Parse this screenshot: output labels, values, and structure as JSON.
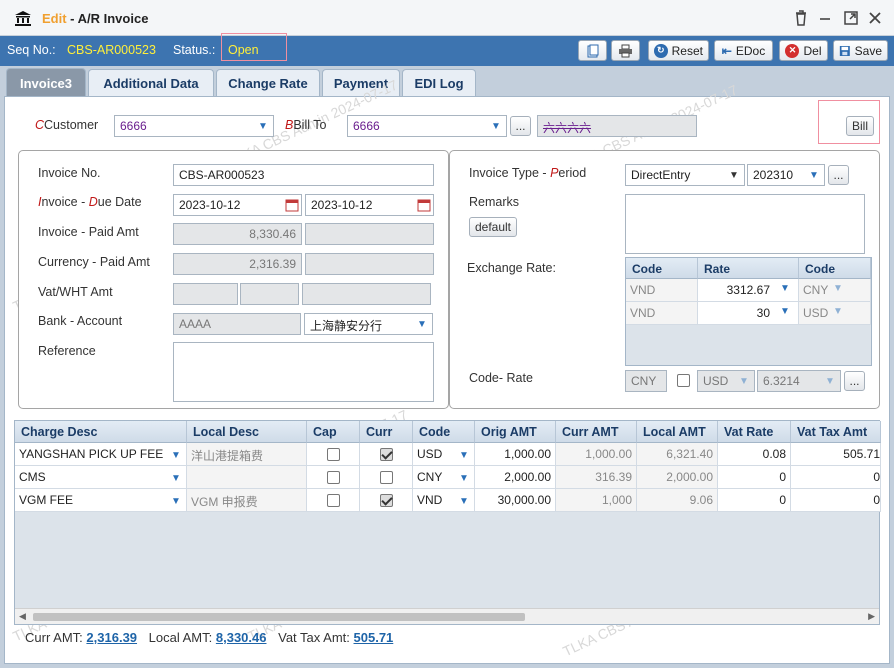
{
  "window": {
    "mode": "Edit",
    "title_rest": " - A/R Invoice"
  },
  "seq": {
    "label": "Seq No.:",
    "value": "CBS-AR000523",
    "status_label": "Status.:",
    "status_value": "Open"
  },
  "toolbar": {
    "reset": "Reset",
    "edoc": "EDoc",
    "del": "Del",
    "save": "Save"
  },
  "tabs": [
    "Invoice3",
    "Additional Data",
    "Change Rate",
    "Payment",
    "EDI Log"
  ],
  "header": {
    "customer_label": "Customer",
    "customer_value": "6666",
    "billto_label": "Bill To",
    "billto_value": "6666",
    "billto_name": "六六六六",
    "ellipsis": "...",
    "bill_button": "Bill"
  },
  "left": {
    "invoice_no_label": "Invoice No.",
    "invoice_no": "CBS-AR000523",
    "invoice_due_label": "Invoice - Due Date",
    "invoice_date": "2023-10-12",
    "due_date": "2023-10-12",
    "invoice_paid_label": "Invoice - Paid Amt",
    "invoice_amt": "8,330.46",
    "paid_amt": "",
    "currency_paid_label": "Currency - Paid Amt",
    "currency_amt": "2,316.39",
    "vat_label": "Vat/WHT Amt",
    "bank_label": "Bank - Account",
    "bank": "AAAA",
    "account": "上海静安分行",
    "reference_label": "Reference"
  },
  "right": {
    "type_period_label": "Invoice Type - Period",
    "type": "DirectEntry",
    "period": "202310",
    "remarks_label": "Remarks",
    "default_btn": "default",
    "exrate_label": "Exchange Rate:",
    "exrate_headers": [
      "Code",
      "Rate",
      "Code"
    ],
    "exrate_rows": [
      {
        "code": "VND",
        "rate": "3312.67",
        "code2": "CNY"
      },
      {
        "code": "VND",
        "rate": "30",
        "code2": "USD"
      }
    ],
    "code_rate_label": "Code- Rate",
    "code1": "CNY",
    "code2": "USD",
    "rate": "6.3214"
  },
  "grid": {
    "headers": [
      "Charge Desc",
      "Local Desc",
      "Cap",
      "Curr",
      "Code",
      "Orig AMT",
      "Curr AMT",
      "Local AMT",
      "Vat Rate",
      "Vat Tax Amt"
    ],
    "rows": [
      {
        "charge": "YANGSHAN PICK UP FEE",
        "local": "洋山港提箱费",
        "cap": false,
        "curr": true,
        "code": "USD",
        "orig": "1,000.00",
        "curr_amt": "1,000.00",
        "local_amt": "6,321.40",
        "vat_rate": "0.08",
        "vat_tax": "505.71"
      },
      {
        "charge": "CMS",
        "local": "",
        "cap": false,
        "curr": false,
        "code": "CNY",
        "orig": "2,000.00",
        "curr_amt": "316.39",
        "local_amt": "2,000.00",
        "vat_rate": "0",
        "vat_tax": "0"
      },
      {
        "charge": "VGM FEE",
        "local": "VGM 申报费",
        "cap": false,
        "curr": true,
        "code": "VND",
        "orig": "30,000.00",
        "curr_amt": "1,000",
        "local_amt": "9.06",
        "vat_rate": "0",
        "vat_tax": "0"
      }
    ]
  },
  "footer": {
    "curr_label": "Curr AMT:",
    "curr": "2,316.39",
    "local_label": "Local AMT:",
    "local": "8,330.46",
    "vat_label": "Vat Tax Amt:",
    "vat": "505.71"
  },
  "watermark": "TLKA CBS Admin 2024-07-17",
  "colors": {
    "header_blue": "#3d74b0",
    "status_yellow": "#ffef3a",
    "edit_orange": "#f0a030",
    "required_red": "#c01818"
  }
}
